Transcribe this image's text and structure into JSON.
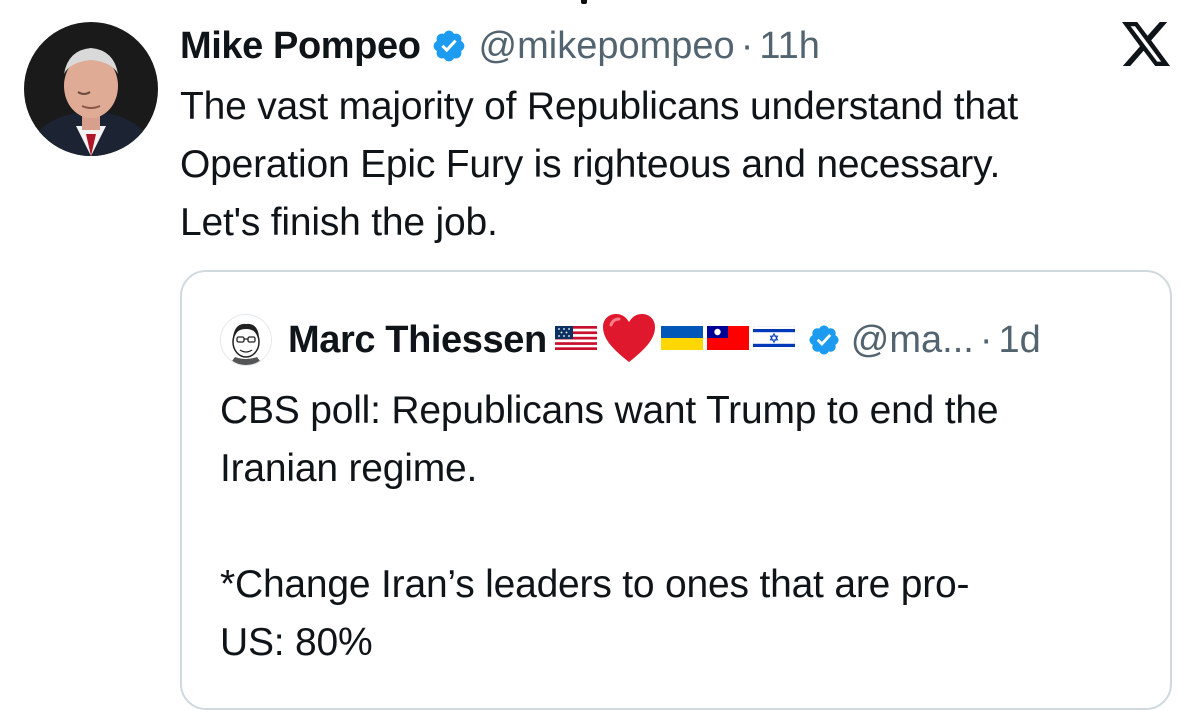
{
  "tweet": {
    "author_name": "Mike Pompeo",
    "handle": "@mikepompeo",
    "separator": "·",
    "time": "11h",
    "text_lines": [
      "The vast majority of Republicans understand that",
      "Operation Epic Fury is righteous and necessary.",
      "Let's finish the job."
    ]
  },
  "quote": {
    "author_name": "Marc Thiessen",
    "handle": "@ma...",
    "separator": "·",
    "time": "1d",
    "flag_icons": [
      "us-flag-icon",
      "red-heart-icon",
      "ukraine-flag-icon",
      "taiwan-flag-icon",
      "israel-flag-icon"
    ],
    "text_lines": [
      "CBS poll: Republicans want Trump to end the",
      "Iranian regime.",
      "",
      "*Change Iran’s leaders to ones that are pro-",
      "US: 80%"
    ]
  },
  "colors": {
    "verified_blue": "#1d9bf0",
    "secondary_text": "#536471",
    "primary_text": "#0f1419",
    "border": "#cfd9de"
  }
}
